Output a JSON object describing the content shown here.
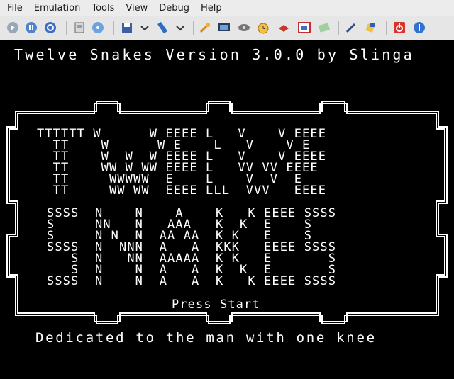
{
  "menu": [
    "File",
    "Emulation",
    "Tools",
    "View",
    "Debug",
    "Help"
  ],
  "toolbar_icons": [
    "reset-icon",
    "pause-icon",
    "refresh-icon",
    "cartridge-icon",
    "disc-icon",
    "save-icon",
    "chevron-down-icon",
    "usb-stick-icon",
    "chevron-down-icon",
    "settings-wrench-icon",
    "monitor-icon",
    "cd-drive-icon",
    "alarm-clock-icon",
    "cpu-chip-icon",
    "fullscreen-icon",
    "palette-icon",
    "edit-pen-icon",
    "debug-tool-icon",
    "power-icon",
    "info-icon"
  ],
  "screen": {
    "title": "Twelve Snakes Version 3.0.0 by Slinga",
    "big_twelve": [
      "TTTTTT W      W EEEE L   V    V EEEE",
      "  TT    W      W E    L   V    V E",
      "  TT    W  W  W EEEE L   V    V EEEE",
      "  TT    WW W WW EEEE L   VV VV EEEE",
      "  TT     WWWWW  E    L    V  V  E",
      "  TT     WW WW  EEEE LLL  VVV   EEEE"
    ],
    "big_snakes": [
      "SSSS  N    N    A    K   K EEEE SSSS",
      "S     NN   N   AAA   K  K  E    S",
      "S     N N  N  AA AA  K K   E    S",
      "SSSS  N  NNN  A   A  KKK   EEEE SSSS",
      "   S  N   NN  AAAAA  K K   E       S",
      "   S  N    N  A   A  K  K  E       S",
      "SSSS  N    N  A   A  K   K EEEE SSSS"
    ],
    "prompt": "Press Start",
    "dedication": "Dedicated to the man with one knee"
  }
}
